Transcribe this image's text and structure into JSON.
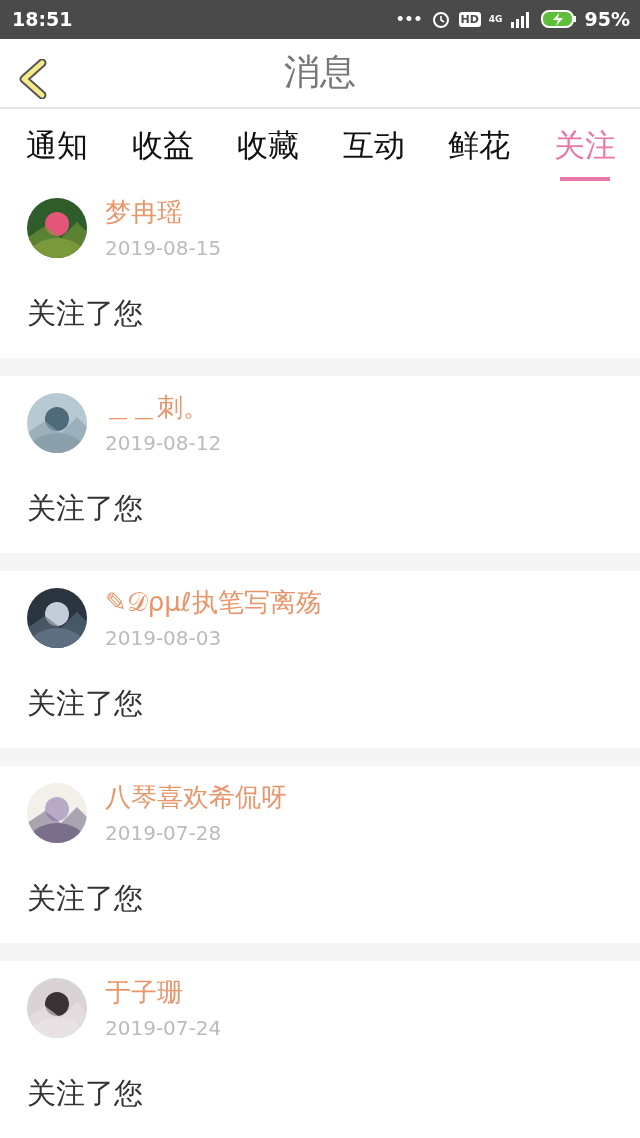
{
  "status_bar": {
    "time": "18:51",
    "dots": "•••",
    "hd": "HD",
    "network": "4G",
    "battery": "95%"
  },
  "header": {
    "title": "消息"
  },
  "tabs": [
    {
      "label": "通知",
      "selected": false
    },
    {
      "label": "收益",
      "selected": false
    },
    {
      "label": "收藏",
      "selected": false
    },
    {
      "label": "互动",
      "selected": false
    },
    {
      "label": "鲜花",
      "selected": false
    },
    {
      "label": "关注",
      "selected": true
    }
  ],
  "messages": [
    {
      "name": "梦冉瑶",
      "date": "2019-08-15",
      "text": "关注了您"
    },
    {
      "name": "＿＿刺。",
      "date": "2019-08-12",
      "text": "关注了您"
    },
    {
      "name": "✎𝒟ρμℓ执笔写离殇",
      "date": "2019-08-03",
      "text": "关注了您"
    },
    {
      "name": "八琴喜欢希侃呀",
      "date": "2019-07-28",
      "text": "关注了您"
    },
    {
      "name": "于子珊",
      "date": "2019-07-24",
      "text": "关注了您"
    }
  ]
}
